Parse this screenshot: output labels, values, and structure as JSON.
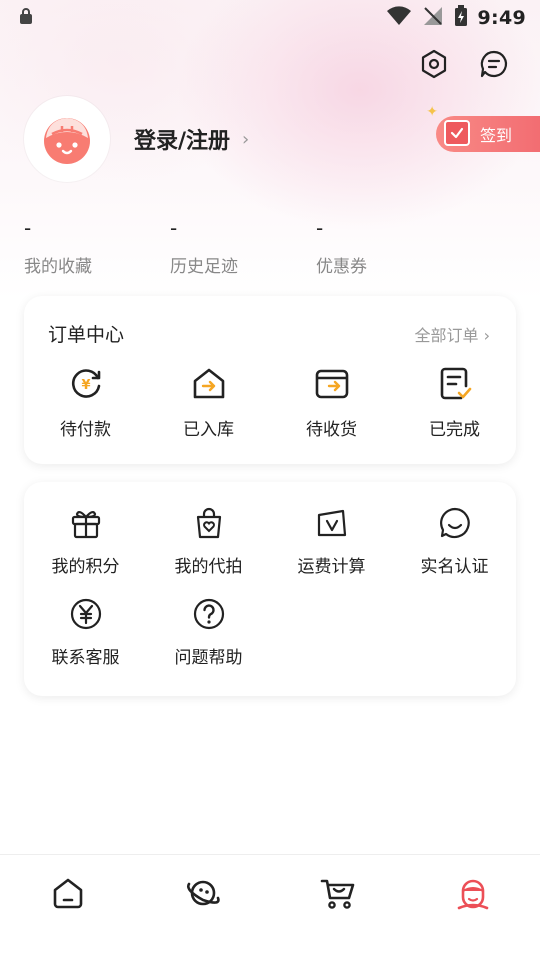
{
  "status_bar": {
    "time": "9:49"
  },
  "profile": {
    "login_label": "登录/注册",
    "chevron": "›"
  },
  "checkin": {
    "label": "签到"
  },
  "stats": [
    {
      "value": "-",
      "label": "我的收藏"
    },
    {
      "value": "-",
      "label": "历史足迹"
    },
    {
      "value": "-",
      "label": "优惠券"
    }
  ],
  "orders": {
    "title": "订单中心",
    "all_label": "全部订单 ›",
    "items": [
      {
        "label": "待付款",
        "icon": "pending-payment-icon"
      },
      {
        "label": "已入库",
        "icon": "warehoused-icon"
      },
      {
        "label": "待收货",
        "icon": "pending-receipt-icon"
      },
      {
        "label": "已完成",
        "icon": "completed-icon"
      }
    ]
  },
  "tools": {
    "items": [
      {
        "label": "我的积分",
        "icon": "gift-icon"
      },
      {
        "label": "我的代拍",
        "icon": "shopping-bag-icon"
      },
      {
        "label": "运费计算",
        "icon": "shipping-calculator-icon"
      },
      {
        "label": "实名认证",
        "icon": "chat-smile-icon"
      },
      {
        "label": "联系客服",
        "icon": "yen-circle-icon"
      },
      {
        "label": "问题帮助",
        "icon": "help-icon"
      }
    ]
  },
  "colors": {
    "accent": "#f26d72",
    "accent_orange": "#f5a623",
    "text": "#222222",
    "muted": "#888888"
  },
  "bottom_nav": [
    {
      "icon": "home-icon",
      "active": false
    },
    {
      "icon": "planet-icon",
      "active": false
    },
    {
      "icon": "cart-icon",
      "active": false
    },
    {
      "icon": "profile-icon",
      "active": true
    }
  ]
}
